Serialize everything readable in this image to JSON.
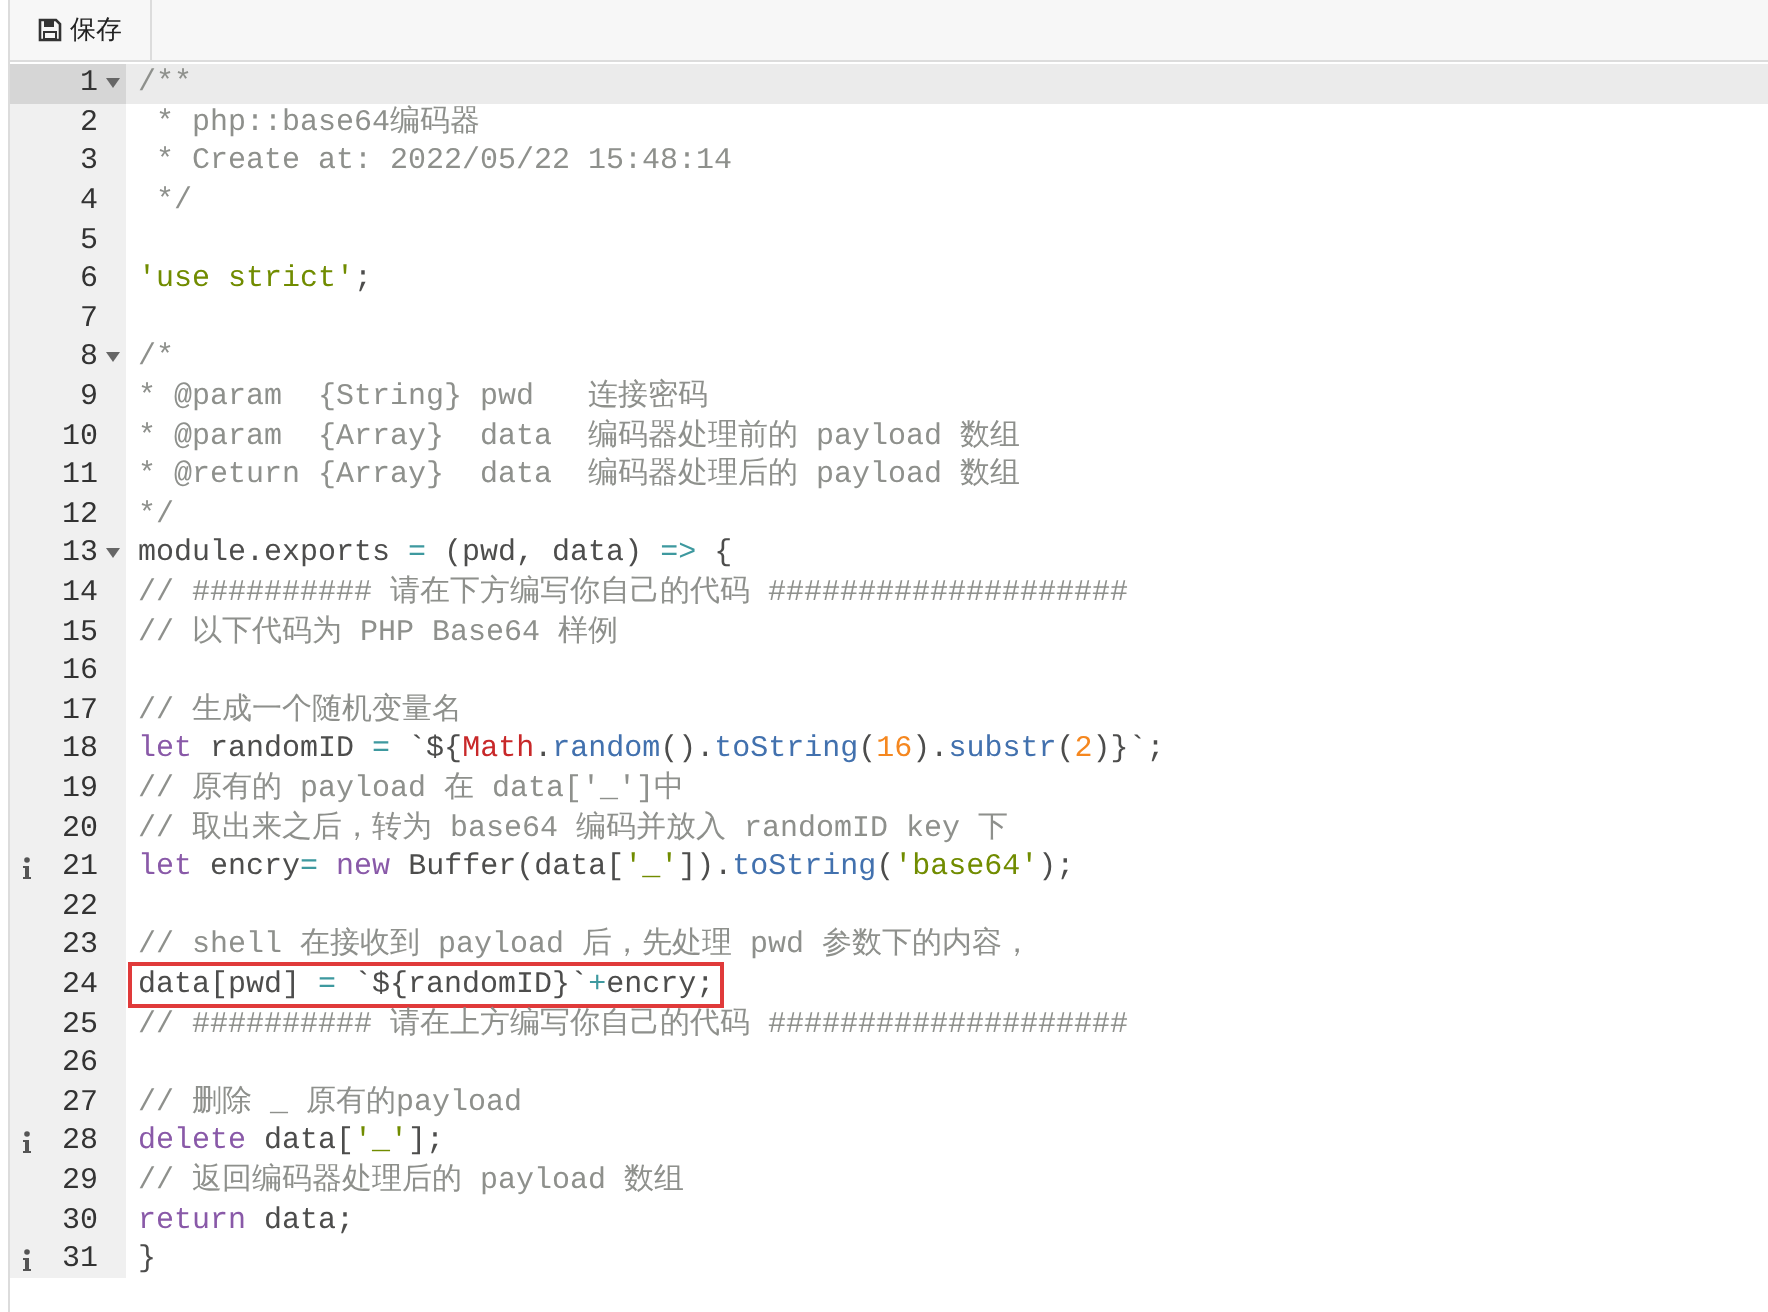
{
  "toolbar": {
    "save_button": "保存"
  },
  "editor": {
    "lines": [
      {
        "number": "1",
        "fold": true,
        "active": true,
        "info": false,
        "boxed": false,
        "tokens": [
          {
            "kind": "comment",
            "text": "/**"
          }
        ]
      },
      {
        "number": "2",
        "fold": false,
        "active": false,
        "info": false,
        "boxed": false,
        "tokens": [
          {
            "kind": "comment",
            "text": " * php::base64编码器"
          }
        ]
      },
      {
        "number": "3",
        "fold": false,
        "active": false,
        "info": false,
        "boxed": false,
        "tokens": [
          {
            "kind": "comment",
            "text": " * Create at: 2022/05/22 15:48:14"
          }
        ]
      },
      {
        "number": "4",
        "fold": false,
        "active": false,
        "info": false,
        "boxed": false,
        "tokens": [
          {
            "kind": "comment",
            "text": " */"
          }
        ]
      },
      {
        "number": "5",
        "fold": false,
        "active": false,
        "info": false,
        "boxed": false
      },
      {
        "number": "6",
        "fold": false,
        "active": false,
        "info": false,
        "boxed": false,
        "tokens": [
          {
            "kind": "string",
            "text": "'use strict'"
          },
          {
            "kind": "plain",
            "text": ";"
          }
        ]
      },
      {
        "number": "7",
        "fold": false,
        "active": false,
        "info": false,
        "boxed": false
      },
      {
        "number": "8",
        "fold": true,
        "active": false,
        "info": false,
        "boxed": false,
        "tokens": [
          {
            "kind": "comment",
            "text": "/*"
          }
        ]
      },
      {
        "number": "9",
        "fold": false,
        "active": false,
        "info": false,
        "boxed": false,
        "tokens": [
          {
            "kind": "comment",
            "text": "* @param  {String} pwd   连接密码"
          }
        ]
      },
      {
        "number": "10",
        "fold": false,
        "active": false,
        "info": false,
        "boxed": false,
        "tokens": [
          {
            "kind": "comment",
            "text": "* @param  {Array}  data  编码器处理前的 payload 数组"
          }
        ]
      },
      {
        "number": "11",
        "fold": false,
        "active": false,
        "info": false,
        "boxed": false,
        "tokens": [
          {
            "kind": "comment",
            "text": "* @return {Array}  data  编码器处理后的 payload 数组"
          }
        ]
      },
      {
        "number": "12",
        "fold": false,
        "active": false,
        "info": false,
        "boxed": false,
        "tokens": [
          {
            "kind": "comment",
            "text": "*/"
          }
        ]
      },
      {
        "number": "13",
        "fold": true,
        "active": false,
        "info": false,
        "boxed": false,
        "tokens": [
          {
            "kind": "plain",
            "text": "module.exports "
          },
          {
            "kind": "operator",
            "text": "="
          },
          {
            "kind": "plain",
            "text": " (pwd, data) "
          },
          {
            "kind": "operator",
            "text": "=>"
          },
          {
            "kind": "plain",
            "text": " {"
          }
        ]
      },
      {
        "number": "14",
        "fold": false,
        "active": false,
        "info": false,
        "boxed": false,
        "tokens": [
          {
            "kind": "comment",
            "text": "// ########## 请在下方编写你自己的代码 ####################"
          }
        ]
      },
      {
        "number": "15",
        "fold": false,
        "active": false,
        "info": false,
        "boxed": false,
        "tokens": [
          {
            "kind": "comment",
            "text": "// 以下代码为 PHP Base64 样例"
          }
        ]
      },
      {
        "number": "16",
        "fold": false,
        "active": false,
        "info": false,
        "boxed": false
      },
      {
        "number": "17",
        "fold": false,
        "active": false,
        "info": false,
        "boxed": false,
        "tokens": [
          {
            "kind": "comment",
            "text": "// 生成一个随机变量名"
          }
        ]
      },
      {
        "number": "18",
        "fold": false,
        "active": false,
        "info": false,
        "boxed": false,
        "tokens": [
          {
            "kind": "keyword",
            "text": "let"
          },
          {
            "kind": "plain",
            "text": " randomID "
          },
          {
            "kind": "operator",
            "text": "="
          },
          {
            "kind": "plain",
            "text": " `${"
          },
          {
            "kind": "variable",
            "text": "Math"
          },
          {
            "kind": "plain",
            "text": "."
          },
          {
            "kind": "function",
            "text": "random"
          },
          {
            "kind": "plain",
            "text": "()."
          },
          {
            "kind": "function",
            "text": "toString"
          },
          {
            "kind": "plain",
            "text": "("
          },
          {
            "kind": "number",
            "text": "16"
          },
          {
            "kind": "plain",
            "text": ")."
          },
          {
            "kind": "function",
            "text": "substr"
          },
          {
            "kind": "plain",
            "text": "("
          },
          {
            "kind": "number",
            "text": "2"
          },
          {
            "kind": "plain",
            "text": ")}`;"
          }
        ]
      },
      {
        "number": "19",
        "fold": false,
        "active": false,
        "info": false,
        "boxed": false,
        "tokens": [
          {
            "kind": "comment",
            "text": "// 原有的 payload 在 data['_']中"
          }
        ]
      },
      {
        "number": "20",
        "fold": false,
        "active": false,
        "info": false,
        "boxed": false,
        "tokens": [
          {
            "kind": "comment",
            "text": "// 取出来之后，转为 base64 编码并放入 randomID key 下"
          }
        ]
      },
      {
        "number": "21",
        "fold": false,
        "active": false,
        "info": true,
        "boxed": false,
        "tokens": [
          {
            "kind": "keyword",
            "text": "let"
          },
          {
            "kind": "plain",
            "text": " encry"
          },
          {
            "kind": "operator",
            "text": "="
          },
          {
            "kind": "keyword",
            "text": " new"
          },
          {
            "kind": "plain",
            "text": " Buffer(data["
          },
          {
            "kind": "string",
            "text": "'_'"
          },
          {
            "kind": "plain",
            "text": "])."
          },
          {
            "kind": "function",
            "text": "toString"
          },
          {
            "kind": "plain",
            "text": "("
          },
          {
            "kind": "string",
            "text": "'base64'"
          },
          {
            "kind": "plain",
            "text": ");"
          }
        ]
      },
      {
        "number": "22",
        "fold": false,
        "active": false,
        "info": false,
        "boxed": false
      },
      {
        "number": "23",
        "fold": false,
        "active": false,
        "info": false,
        "boxed": false,
        "tokens": [
          {
            "kind": "comment",
            "text": "// shell 在接收到 payload 后，先处理 pwd 参数下的内容，"
          }
        ]
      },
      {
        "number": "24",
        "fold": false,
        "active": false,
        "info": false,
        "boxed": true,
        "tokens": [
          {
            "kind": "plain",
            "text": "data[pwd] "
          },
          {
            "kind": "operator",
            "text": "="
          },
          {
            "kind": "plain",
            "text": " `${randomID}`"
          },
          {
            "kind": "operator",
            "text": "+"
          },
          {
            "kind": "plain",
            "text": "encry;"
          }
        ]
      },
      {
        "number": "25",
        "fold": false,
        "active": false,
        "info": false,
        "boxed": false,
        "tokens": [
          {
            "kind": "comment",
            "text": "// ########## 请在上方编写你自己的代码 ####################"
          }
        ]
      },
      {
        "number": "26",
        "fold": false,
        "active": false,
        "info": false,
        "boxed": false
      },
      {
        "number": "27",
        "fold": false,
        "active": false,
        "info": false,
        "boxed": false,
        "tokens": [
          {
            "kind": "comment",
            "text": "// 删除 _ 原有的payload"
          }
        ]
      },
      {
        "number": "28",
        "fold": false,
        "active": false,
        "info": true,
        "boxed": false,
        "tokens": [
          {
            "kind": "keyword",
            "text": "delete"
          },
          {
            "kind": "plain",
            "text": " data["
          },
          {
            "kind": "string",
            "text": "'_'"
          },
          {
            "kind": "plain",
            "text": "];"
          }
        ]
      },
      {
        "number": "29",
        "fold": false,
        "active": false,
        "info": false,
        "boxed": false,
        "tokens": [
          {
            "kind": "comment",
            "text": "// 返回编码器处理后的 payload 数组"
          }
        ]
      },
      {
        "number": "30",
        "fold": false,
        "active": false,
        "info": false,
        "boxed": false,
        "tokens": [
          {
            "kind": "keyword",
            "text": "return"
          },
          {
            "kind": "plain",
            "text": " data;"
          }
        ]
      },
      {
        "number": "31",
        "fold": false,
        "active": false,
        "info": true,
        "boxed": false,
        "tokens": [
          {
            "kind": "plain",
            "text": "}"
          }
        ]
      }
    ]
  }
}
